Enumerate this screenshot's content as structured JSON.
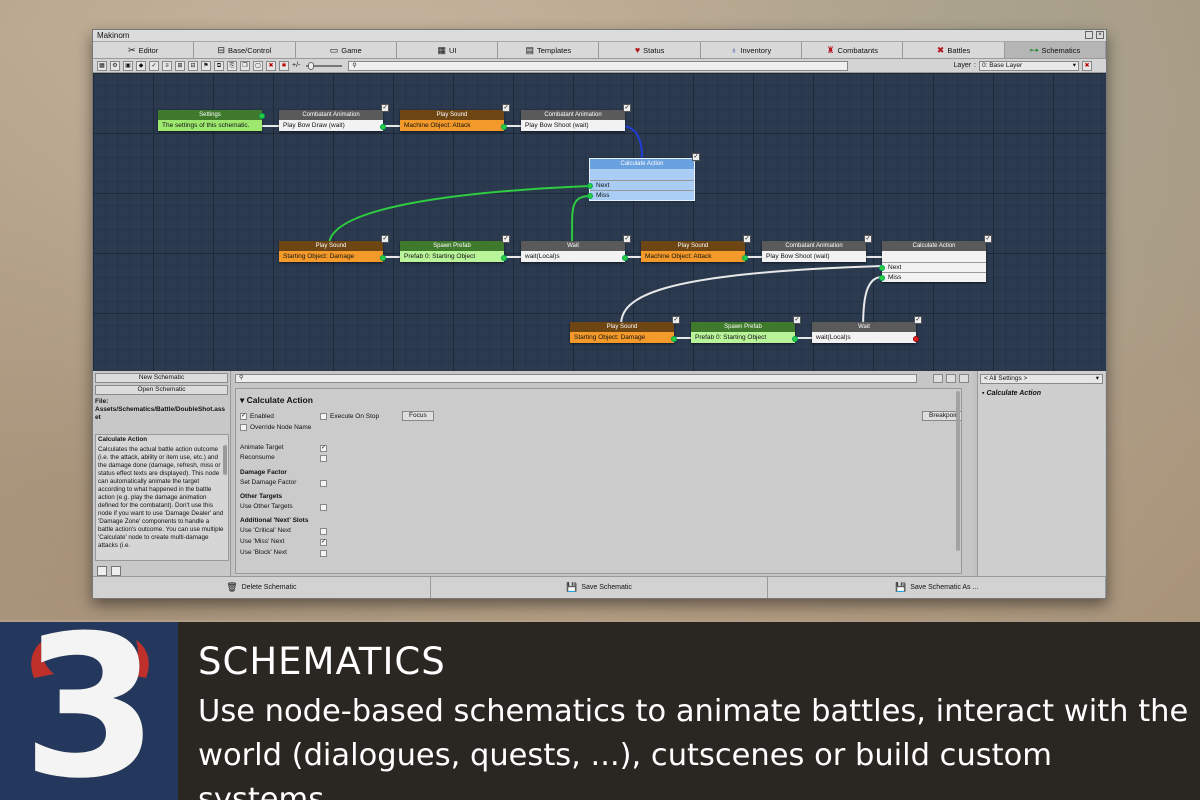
{
  "window": {
    "title": "Makinom",
    "tabs": [
      {
        "label": "Editor",
        "icon": "tools-icon"
      },
      {
        "label": "Base/Control",
        "icon": "gamepad-icon"
      },
      {
        "label": "Game",
        "icon": "monitor-icon"
      },
      {
        "label": "UI",
        "icon": "ui-icon"
      },
      {
        "label": "Templates",
        "icon": "document-icon"
      },
      {
        "label": "Status",
        "icon": "heart-icon"
      },
      {
        "label": "Inventory",
        "icon": "potion-icon"
      },
      {
        "label": "Combatants",
        "icon": "combatant-icon"
      },
      {
        "label": "Battles",
        "icon": "swords-icon"
      },
      {
        "label": "Schematics",
        "icon": "schematics-icon",
        "active": true
      }
    ],
    "toolbar": {
      "zoom_label": "+/-",
      "layer_label": "Layer",
      "layer_value": "0: Base Layer"
    }
  },
  "nodes": {
    "settings": {
      "header": "Settings",
      "body": "The settings of this schematic."
    },
    "combatant_anim_1": {
      "header": "Combatant Animation",
      "body": "Play Bow Draw (wait)"
    },
    "play_sound_1": {
      "header": "Play Sound",
      "body": "Machine Object: Attack"
    },
    "combatant_anim_2": {
      "header": "Combatant Animation",
      "body": "Play Bow Shoot (wait)"
    },
    "calc_action_1": {
      "header": "Calculate Action",
      "next": "Next",
      "miss": "Miss"
    },
    "play_sound_2": {
      "header": "Play Sound",
      "body": "Starting Object: Damage"
    },
    "spawn_prefab_1": {
      "header": "Spawn Prefab",
      "body": "Prefab 0: Starting Object"
    },
    "wait_1": {
      "header": "Wait",
      "body": "wait(Local)s"
    },
    "play_sound_3": {
      "header": "Play Sound",
      "body": "Machine Object: Attack"
    },
    "combatant_anim_3": {
      "header": "Combatant Animation",
      "body": "Play Bow Shoot (wait)"
    },
    "calc_action_2": {
      "header": "Calculate Action",
      "next": "Next",
      "miss": "Miss"
    },
    "play_sound_4": {
      "header": "Play Sound",
      "body": "Starting Object: Damage"
    },
    "spawn_prefab_2": {
      "header": "Spawn Prefab",
      "body": "Prefab 0: Starting Object"
    },
    "wait_2": {
      "header": "Wait",
      "body": "wait(Local)s"
    }
  },
  "left_panel": {
    "new_schematic": "New Schematic",
    "open_schematic": "Open Schematic",
    "file_label": "File:",
    "file_path": "Assets/Schematics/Battle/DoubleShot.asset",
    "help_title": "Calculate Action",
    "help_text": "Calculates the actual battle action outcome (i.e. the attack, ability or item use, etc.) and the damage done (damage, refresh, miss or status effect texts are displayed). This node can automatically animate the target according to what happened in the battle action (e.g. play the damage animation defined for the combatant). Don't use this node if you want to use 'Damage Dealer' and 'Damage Zone' components to handle a battle action's outcome. You can use multiple 'Calculate' node to create multi-damage attacks (i.e."
  },
  "inspector": {
    "title": "Calculate Action",
    "enabled": "Enabled",
    "execute_on_stop": "Execute On Stop",
    "focus": "Focus",
    "breakpoint": "Breakpoint",
    "override_node_name": "Override Node Name",
    "animate_target": "Animate Target",
    "reconsume": "Reconsume",
    "damage_factor_section": "Damage Factor",
    "set_damage_factor": "Set Damage Factor",
    "other_targets_section": "Other Targets",
    "use_other_targets": "Use Other Targets",
    "additional_next_section": "Additional 'Next' Slots",
    "use_critical_next": "Use 'Critical' Next",
    "use_miss_next": "Use 'Miss' Next",
    "use_block_next": "Use 'Block' Next",
    "checks": {
      "enabled": true,
      "execute_on_stop": false,
      "override_node_name": false,
      "animate_target": true,
      "reconsume": false,
      "set_damage_factor": false,
      "use_other_targets": false,
      "use_critical_next": false,
      "use_miss_next": true,
      "use_block_next": false
    }
  },
  "right_panel": {
    "dropdown": "< All Settings >",
    "item": "Calculate Action"
  },
  "bottom_bar": {
    "delete": "Delete Schematic",
    "save": "Save Schematic",
    "save_as": "Save Schematic As ..."
  },
  "banner": {
    "number": "3",
    "title": "SCHEMATICS",
    "description": "Use node-based schematics to animate battles, interact with the world (dialogues, quests, ...), cutscenes or build custom systems."
  },
  "colors": {
    "banner_bg": "#2a2622",
    "badge_bg": "#24385e",
    "horn_red": "#c0302a",
    "canvas_bg": "#2b3a4f",
    "node_orange": "#f39a2a",
    "node_green": "#9fe870",
    "node_blue": "#a9cdf4",
    "connection_green": "#2ecc40",
    "connection_blue": "#1f3fd6",
    "connection_white": "#e8e8e8"
  }
}
